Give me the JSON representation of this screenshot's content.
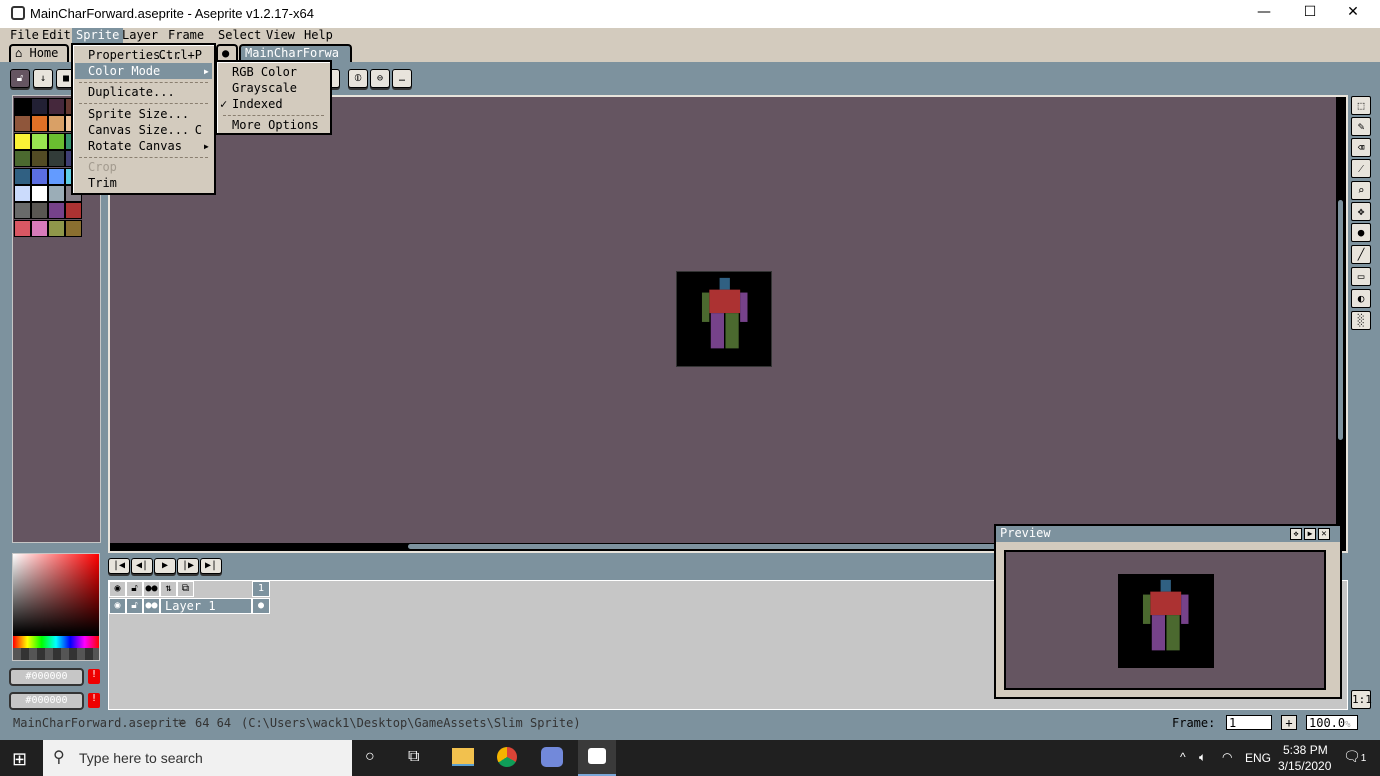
{
  "window": {
    "title": "MainCharForward.aseprite - Aseprite v1.2.17-x64",
    "minimize": "—",
    "maximize": "☐",
    "close": "✕"
  },
  "menubar": [
    "File",
    "Edit",
    "Sprite",
    "Layer",
    "Frame",
    "Select",
    "View",
    "Help"
  ],
  "tabs": {
    "home": "Home",
    "file": "MainCharForwa"
  },
  "sprite_menu": {
    "items": [
      {
        "label": "Properties...",
        "shortcut": "Ctrl+P"
      },
      {
        "label": "Color Mode",
        "submenu": true,
        "highlighted": true
      },
      {
        "label": "Duplicate..."
      },
      {
        "label": "Sprite Size..."
      },
      {
        "label": "Canvas Size...",
        "shortcut": "C"
      },
      {
        "label": "Rotate Canvas",
        "submenu": true
      },
      {
        "label": "Crop",
        "disabled": true
      },
      {
        "label": "Trim"
      }
    ]
  },
  "color_mode_menu": {
    "items": [
      {
        "label": "RGB Color"
      },
      {
        "label": "Grayscale"
      },
      {
        "label": "Indexed",
        "checked": true
      },
      {
        "label": "More Options"
      }
    ]
  },
  "palette": [
    "#000000",
    "#222034",
    "#45283c",
    "#663931",
    "#8f563b",
    "#df7126",
    "#d9a066",
    "#eec39a",
    "#fbf236",
    "#99e550",
    "#6abe30",
    "#37946e",
    "#4b692f",
    "#524b24",
    "#323c39",
    "#3f3f74",
    "#306082",
    "#5b6ee1",
    "#639bff",
    "#5fcde4",
    "#cbdbfc",
    "#ffffff",
    "#9badb7",
    "#847e87",
    "#696a6a",
    "#595652",
    "#76428a",
    "#ac3232",
    "#d95763",
    "#d77bba",
    "#8f974a",
    "#8a6f30"
  ],
  "colors": {
    "fg": "#000000",
    "bg": "#000000",
    "canvas_bg": "#655561",
    "ui_bg": "#7d929e"
  },
  "timeline": {
    "frame_header": "1",
    "layers": [
      {
        "name": "Layer 1"
      }
    ]
  },
  "preview": {
    "title": "Preview"
  },
  "status": {
    "filename": "MainCharForward.aseprite",
    "size": "64 64",
    "path": "(C:\\Users\\wack1\\Desktop\\GameAssets\\Slim Sprite)",
    "frame_label": "Frame:",
    "frame_value": "1",
    "zoom": "100.0",
    "zoom_unit": "%"
  },
  "taskbar": {
    "search_placeholder": "Type here to search",
    "time": "5:38 PM",
    "date": "3/15/2020",
    "lang": "ENG",
    "notifications": "1"
  }
}
